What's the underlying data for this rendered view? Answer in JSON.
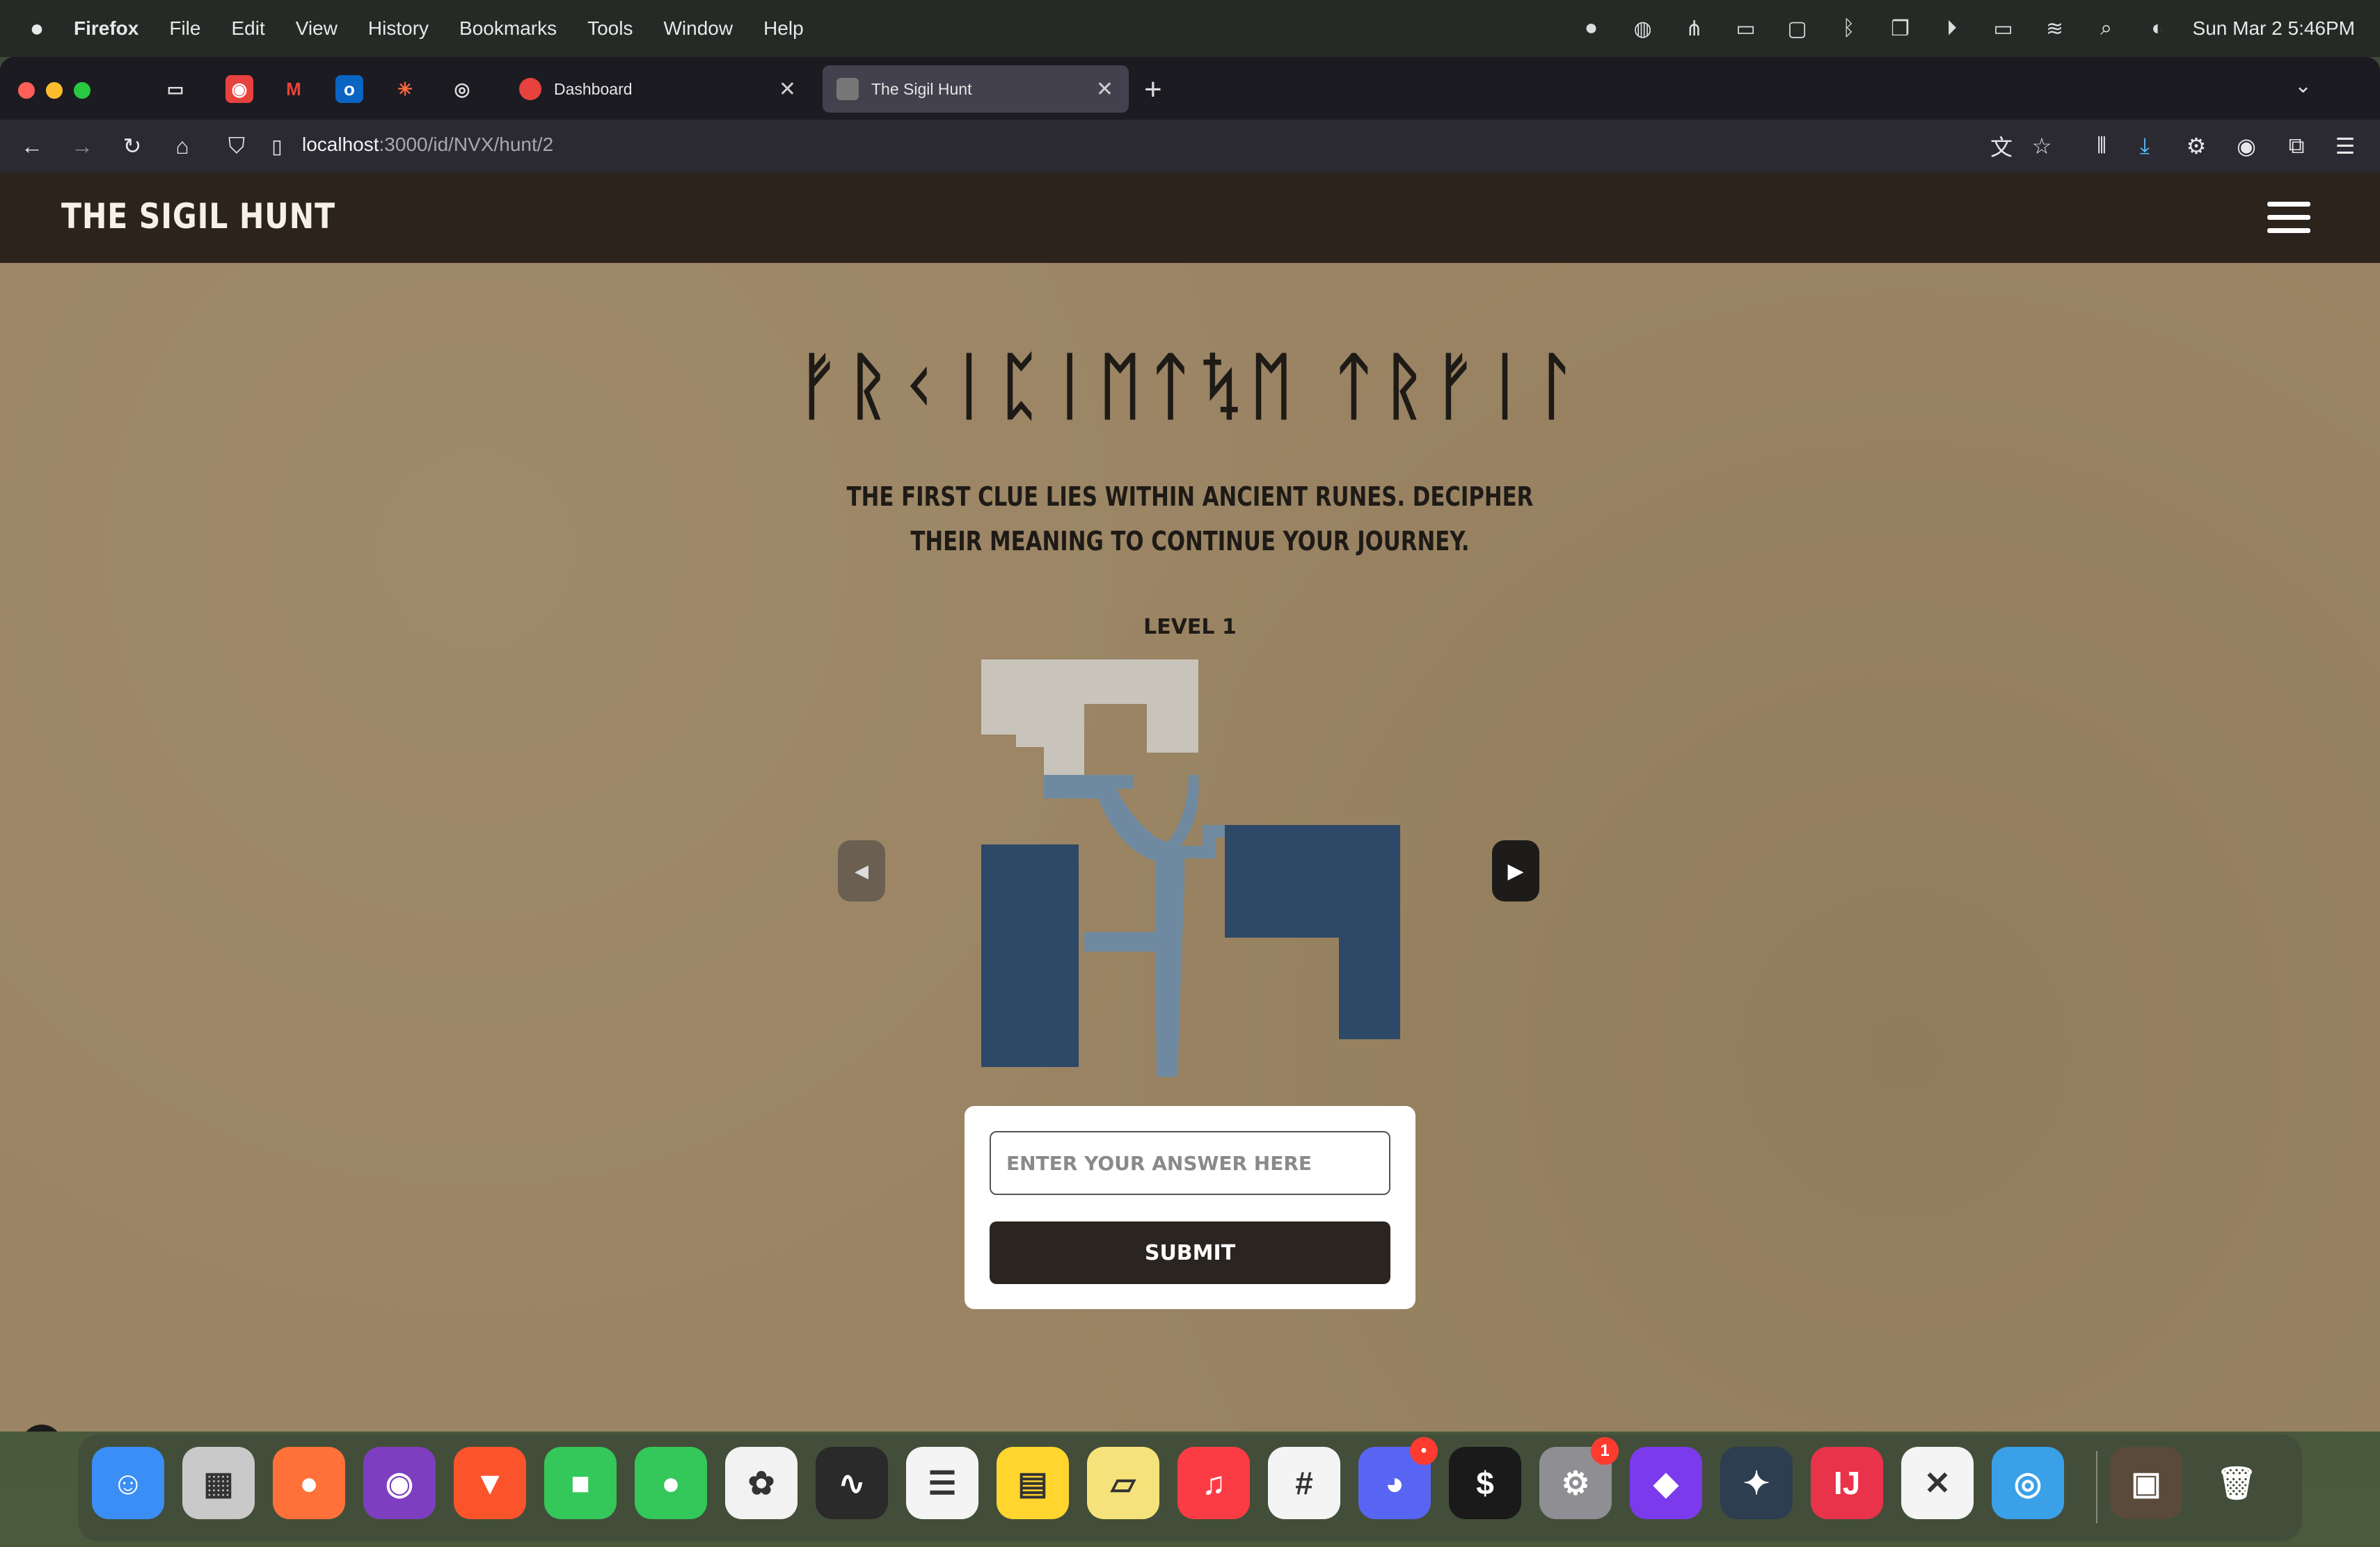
{
  "menubar": {
    "app": "Firefox",
    "items": [
      "File",
      "Edit",
      "View",
      "History",
      "Bookmarks",
      "Tools",
      "Window",
      "Help"
    ],
    "clock": "Sun Mar 2  5:46PM"
  },
  "browser": {
    "tabs": [
      {
        "label": "Dashboard",
        "favicon_color": "#e8423f"
      },
      {
        "label": "The Sigil Hunt",
        "favicon_color": "#777"
      }
    ],
    "url_host": "localhost",
    "url_path": ":3000/id/NVX/hunt/2"
  },
  "site": {
    "title": "THE SIGIL HUNT",
    "rune_title": "ᚠᚱᚲᛁᛈᛁᛖᛏᛪᛖ ᛏᚱᚠᛁᛚ",
    "clue": "The first clue lies within ancient runes. Decipher their meaning to continue your journey.",
    "level": "LEVEL 1",
    "prev_label": "◀",
    "next_label": "▶",
    "answer_placeholder": "Enter your answer here",
    "submit_label": "SUBMIT"
  },
  "colors": {
    "page_bg": "#9a8463",
    "header_bg": "#2c231d",
    "puzzle_dark_blue": "#2e4868",
    "puzzle_steel_blue": "#6f8aa0",
    "puzzle_light_gray": "#c8c4bb",
    "submit_bg": "#2b2521"
  },
  "dock": {
    "apps": [
      {
        "name": "finder-icon",
        "glyph": "☺",
        "bg": "#3a8ef5"
      },
      {
        "name": "launchpad-icon",
        "glyph": "▦",
        "bg": "#c9c9c9"
      },
      {
        "name": "firefox-icon",
        "glyph": "●",
        "bg": "#ff7139"
      },
      {
        "name": "tor-icon",
        "glyph": "◉",
        "bg": "#7d3fbf"
      },
      {
        "name": "brave-icon",
        "glyph": "▼",
        "bg": "#fb542b"
      },
      {
        "name": "facetime-icon",
        "glyph": "■",
        "bg": "#34c759"
      },
      {
        "name": "messages-icon",
        "glyph": "●",
        "bg": "#34c759"
      },
      {
        "name": "photos-icon",
        "glyph": "✿",
        "bg": "#f2f2f2"
      },
      {
        "name": "voice-memos-icon",
        "glyph": "∿",
        "bg": "#2a2a2a"
      },
      {
        "name": "reminders-icon",
        "glyph": "☰",
        "bg": "#f4f4f4"
      },
      {
        "name": "notes-icon",
        "glyph": "▤",
        "bg": "#ffd52e"
      },
      {
        "name": "stickies-icon",
        "glyph": "▱",
        "bg": "#f6e27a"
      },
      {
        "name": "music-icon",
        "glyph": "♫",
        "bg": "#fc3c44"
      },
      {
        "name": "slack-icon",
        "glyph": "#",
        "bg": "#f4f4f4"
      },
      {
        "name": "discord-icon",
        "glyph": "◕",
        "bg": "#5865f2",
        "badge": "•"
      },
      {
        "name": "terminal-icon",
        "glyph": "$",
        "bg": "#1a1a1a"
      },
      {
        "name": "system-settings-icon",
        "glyph": "⚙",
        "bg": "#8e8e93",
        "badge": "1"
      },
      {
        "name": "obsidian-icon",
        "glyph": "◆",
        "bg": "#7c3aed"
      },
      {
        "name": "davinci-icon",
        "glyph": "✦",
        "bg": "#2c3e50"
      },
      {
        "name": "intellij-icon",
        "glyph": "IJ",
        "bg": "#e8334a"
      },
      {
        "name": "vscode-icon",
        "glyph": "✕",
        "bg": "#f4f4f4"
      },
      {
        "name": "proxyman-icon",
        "glyph": "◎",
        "bg": "#3aa0e8"
      },
      {
        "name": "recent-folder-icon",
        "glyph": "▣",
        "bg": "#5a4a3a"
      },
      {
        "name": "trash-icon",
        "glyph": "🗑",
        "bg": "transparent"
      }
    ]
  }
}
